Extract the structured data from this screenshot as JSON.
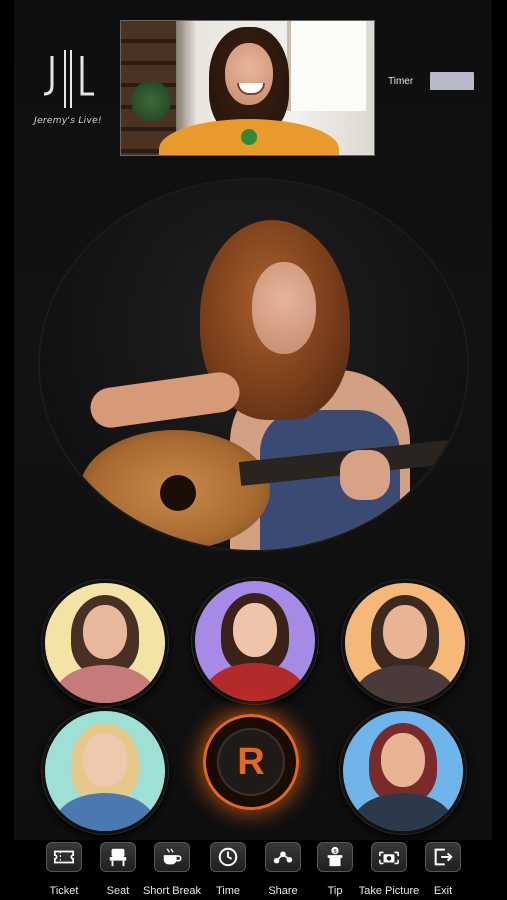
{
  "app": {
    "logo_text": "Jeremy's Live!"
  },
  "header": {
    "timer_label": "Timer",
    "timer_value": ""
  },
  "record_button": {
    "letter": "R"
  },
  "participants": [
    {
      "name": "participant-1",
      "bg": "#f3e4a6",
      "hair": "#4a3024",
      "skin": "#e7b89c",
      "shirt": "#c77a7a"
    },
    {
      "name": "participant-2",
      "bg": "#a68ae6",
      "hair": "#3a2218",
      "skin": "#efc4ab",
      "shirt": "#b42a2a"
    },
    {
      "name": "participant-3",
      "bg": "#f5b878",
      "hair": "#3a2a20",
      "skin": "#e8b494",
      "shirt": "#4a3a3a"
    },
    {
      "name": "participant-4",
      "bg": "#9fe0d6",
      "hair": "#e6c98a",
      "skin": "#f0c8ae",
      "shirt": "#4a78b0"
    },
    {
      "name": "participant-5",
      "bg": "#6fb4ea",
      "hair": "#7a2a2a",
      "skin": "#e8b494",
      "shirt": "#2a3a4a"
    }
  ],
  "toolbar": {
    "items": [
      {
        "id": "ticket",
        "label": "Ticket",
        "icon": "ticket-icon"
      },
      {
        "id": "seat",
        "label": "Seat",
        "icon": "seat-icon"
      },
      {
        "id": "short-break",
        "label": "Short Break",
        "icon": "coffee-icon"
      },
      {
        "id": "time",
        "label": "Time",
        "icon": "clock-icon"
      },
      {
        "id": "share",
        "label": "Share",
        "icon": "share-icon"
      },
      {
        "id": "tip",
        "label": "Tip",
        "icon": "tip-jar-icon"
      },
      {
        "id": "take-picture",
        "label": "Take Picture",
        "icon": "camera-icon"
      },
      {
        "id": "exit",
        "label": "Exit",
        "icon": "exit-icon"
      }
    ]
  },
  "colors": {
    "accent": "#e4651e",
    "timer_box": "#b7b9c9",
    "background": "#000000"
  }
}
